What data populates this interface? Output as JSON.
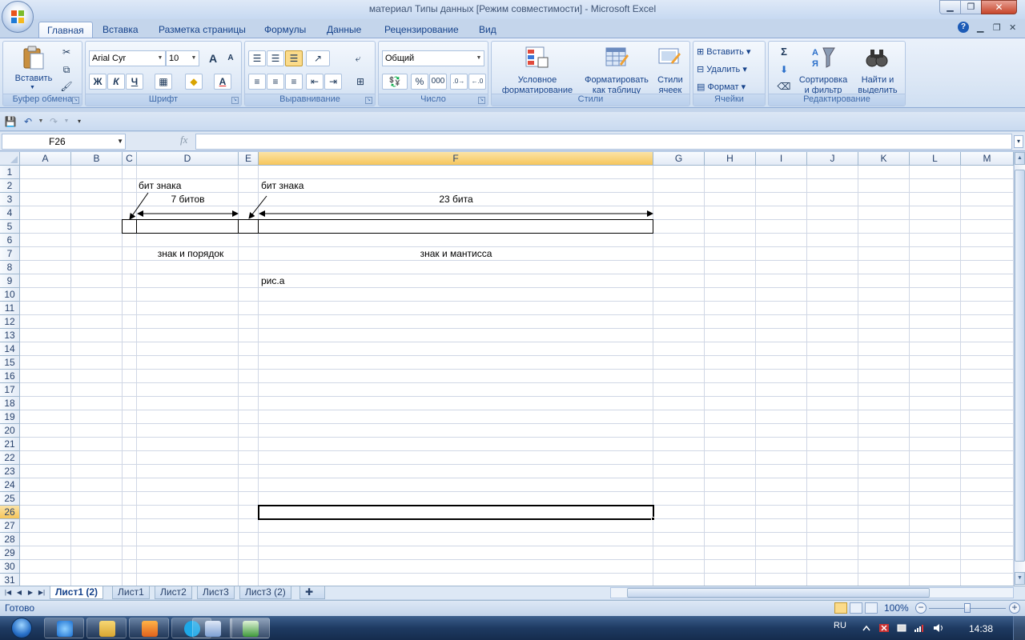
{
  "window": {
    "title": "материал Типы данных  [Режим совместимости] - Microsoft Excel"
  },
  "ribbon_tabs": [
    {
      "label": "Главная",
      "active": true
    },
    {
      "label": "Вставка"
    },
    {
      "label": "Разметка страницы"
    },
    {
      "label": "Формулы"
    },
    {
      "label": "Данные"
    },
    {
      "label": "Рецензирование"
    },
    {
      "label": "Вид"
    }
  ],
  "ribbon": {
    "clipboard": {
      "label": "Буфер обмена",
      "paste": "Вставить"
    },
    "font": {
      "label": "Шрифт",
      "name": "Arial Cyr",
      "size": "10",
      "bold": "Ж",
      "italic": "К",
      "underline": "Ч",
      "grow": "A",
      "shrink": "A",
      "font_color_letter": "A"
    },
    "alignment": {
      "label": "Выравнивание"
    },
    "number": {
      "label": "Число",
      "format": "Общий",
      "percent": "%",
      "thousands": "000"
    },
    "styles": {
      "label": "Стили",
      "cond_format_1": "Условное",
      "cond_format_2": "форматирование",
      "format_table_1": "Форматировать",
      "format_table_2": "как таблицу",
      "cell_styles_1": "Стили",
      "cell_styles_2": "ячеек"
    },
    "cells": {
      "label": "Ячейки",
      "insert": "Вставить",
      "delete": "Удалить",
      "format": "Формат"
    },
    "editing": {
      "label": "Редактирование",
      "sum": "Σ",
      "sort_1": "Сортировка",
      "sort_2": "и фильтр",
      "find_1": "Найти и",
      "find_2": "выделить"
    }
  },
  "formula_bar": {
    "name_box": "F26",
    "fx": "fx",
    "formula": ""
  },
  "columns": [
    "A",
    "B",
    "C",
    "D",
    "E",
    "F",
    "G",
    "H",
    "I",
    "J",
    "K",
    "L",
    "M"
  ],
  "selected_column": "F",
  "rows": [
    "1",
    "2",
    "3",
    "4",
    "5",
    "6",
    "7",
    "8",
    "9",
    "10",
    "11",
    "12",
    "13",
    "14",
    "15",
    "16",
    "17",
    "18",
    "19",
    "20",
    "21",
    "22",
    "23",
    "24",
    "25",
    "26",
    "27",
    "28",
    "29",
    "30",
    "31"
  ],
  "selected_row": "26",
  "cells": {
    "c2": "бит знака",
    "d3": "7 битов",
    "f2": "бит знака",
    "f3": "23 бита",
    "d7": "знак и порядок",
    "f7": "знак и мантисса",
    "f9": "рис.а"
  },
  "sheets": [
    {
      "label": "Лист1 (2)",
      "active": true
    },
    {
      "label": "Лист1"
    },
    {
      "label": "Лист2"
    },
    {
      "label": "Лист3"
    },
    {
      "label": "Лист3 (2)"
    }
  ],
  "status": {
    "ready": "Готово",
    "zoom": "100%"
  },
  "taskbar": {
    "lang": "RU",
    "time": "14:38"
  },
  "colors": {
    "accent": "#15428b",
    "selected_header": "#f6c65c",
    "grid_line": "#d0d7e5"
  }
}
